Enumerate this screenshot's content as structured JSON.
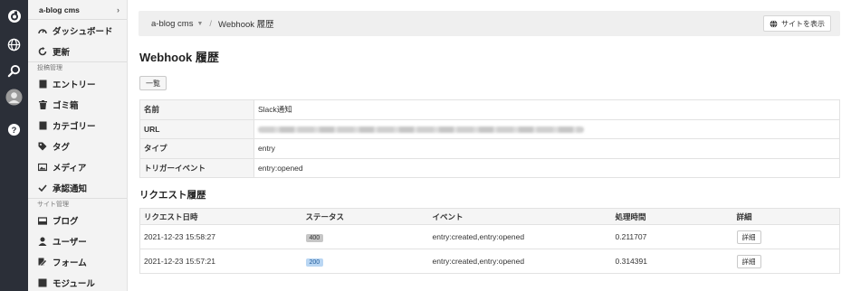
{
  "sidebar": {
    "site_name": "a-blog cms",
    "top_items": [
      {
        "label": "ダッシュボード"
      },
      {
        "label": "更新"
      }
    ],
    "group1": "投稿管理",
    "post_items": [
      {
        "label": "エントリー"
      },
      {
        "label": "ゴミ箱"
      },
      {
        "label": "カテゴリー"
      },
      {
        "label": "タグ"
      },
      {
        "label": "メディア"
      },
      {
        "label": "承認通知"
      }
    ],
    "group2": "サイト管理",
    "site_items": [
      {
        "label": "ブログ"
      },
      {
        "label": "ユーザー"
      },
      {
        "label": "フォーム"
      },
      {
        "label": "モジュール"
      }
    ]
  },
  "header": {
    "breadcrumb_root": "a-blog cms",
    "breadcrumb_current": "Webhook 履歴",
    "view_site": "サイトを表示"
  },
  "page": {
    "title": "Webhook 履歴",
    "list_button": "一覧"
  },
  "info": {
    "name_label": "名前",
    "name_value": "Slack通知",
    "url_label": "URL",
    "type_label": "タイプ",
    "type_value": "entry",
    "trigger_label": "トリガーイベント",
    "trigger_value": "entry:opened"
  },
  "requests": {
    "title": "リクエスト履歴",
    "headers": [
      "リクエスト日時",
      "ステータス",
      "イベント",
      "処理時間",
      "詳細"
    ],
    "rows": [
      {
        "datetime": "2021-12-23 15:58:27",
        "status": "400",
        "event": "entry:created,entry:opened",
        "time": "0.211707",
        "detail": "詳細"
      },
      {
        "datetime": "2021-12-23 15:57:21",
        "status": "200",
        "event": "entry:created,entry:opened",
        "time": "0.314391",
        "detail": "詳細"
      }
    ]
  }
}
